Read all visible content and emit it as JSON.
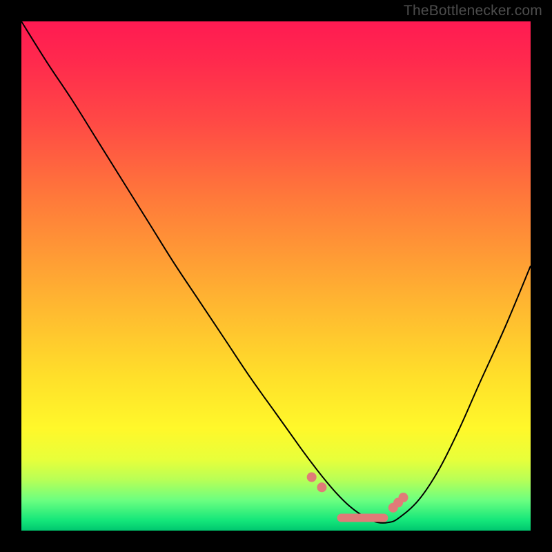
{
  "watermark": "TheBottlenecker.com",
  "chart_data": {
    "type": "line",
    "title": "",
    "xlabel": "",
    "ylabel": "",
    "xlim": [
      0,
      100
    ],
    "ylim": [
      0,
      100
    ],
    "x": [
      0,
      5,
      10,
      15,
      20,
      25,
      30,
      35,
      40,
      45,
      50,
      55,
      58,
      60,
      62,
      64,
      66,
      68,
      70,
      72,
      74,
      78,
      82,
      86,
      90,
      95,
      100
    ],
    "values": [
      100,
      92,
      84.5,
      76.5,
      68.5,
      60.5,
      52.5,
      45,
      37.5,
      30,
      23,
      16,
      12,
      9.5,
      7.2,
      5.2,
      3.6,
      2.4,
      1.6,
      1.6,
      2.4,
      6,
      12,
      20,
      29,
      40,
      52
    ],
    "annotations": {
      "scatter_points": [
        {
          "x": 57,
          "y": 10.5
        },
        {
          "x": 59,
          "y": 8.5
        },
        {
          "x": 73,
          "y": 4.5
        },
        {
          "x": 74,
          "y": 5.5
        },
        {
          "x": 75,
          "y": 6.5
        }
      ],
      "valley_segment": {
        "x1": 62,
        "x2": 72,
        "y": 2.5
      }
    }
  }
}
